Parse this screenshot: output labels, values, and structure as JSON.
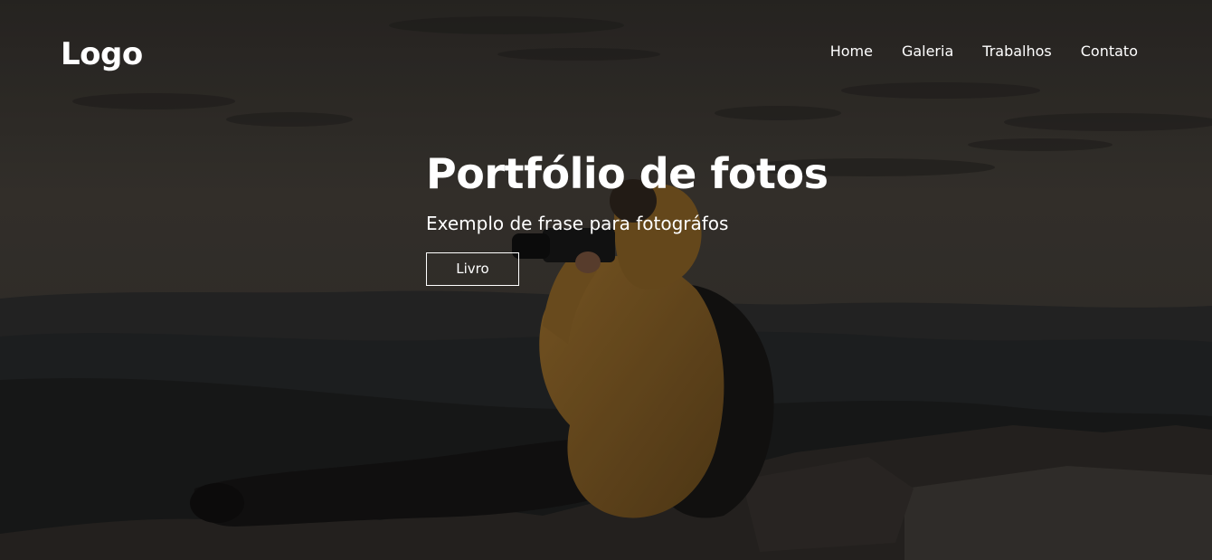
{
  "header": {
    "logo": "Logo",
    "nav": [
      "Home",
      "Galeria",
      "Trabalhos",
      "Contato"
    ]
  },
  "hero": {
    "title": "Portfólio de fotos",
    "subtitle": "Exemplo de frase para fotográfos",
    "cta_label": "Livro",
    "background_image": "photographer-on-mountain-photo"
  },
  "colors": {
    "text": "#ffffff",
    "sky": "#3b3732",
    "jacket": "#8a6328"
  }
}
